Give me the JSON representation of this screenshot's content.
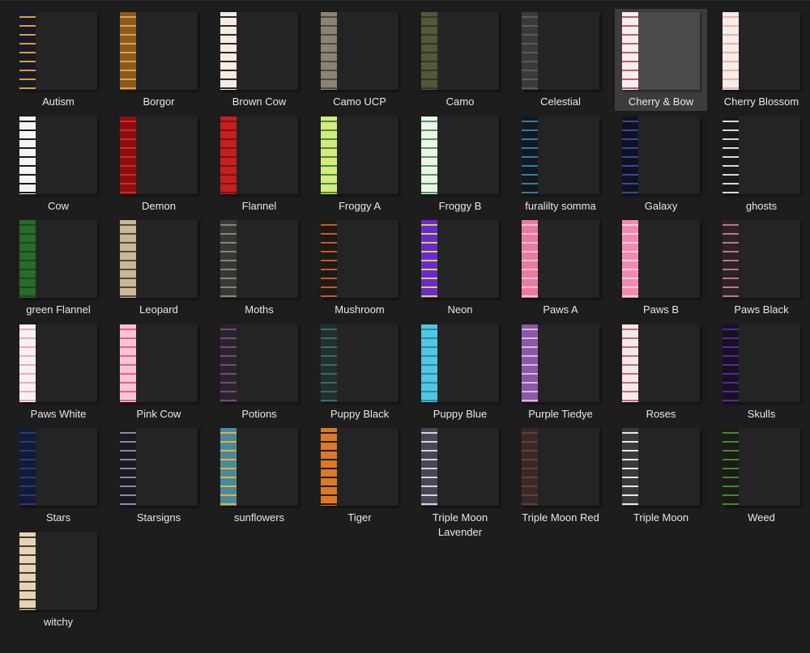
{
  "folder": {
    "items": [
      {
        "label": "Autism",
        "pattern": "autism-pattern",
        "colors": [
          "#1a1a2e",
          "#d9a32b"
        ]
      },
      {
        "label": "Borgor",
        "pattern": "borgor-pattern",
        "colors": [
          "#8a5a1e",
          "#e0a040"
        ]
      },
      {
        "label": "Brown Cow",
        "pattern": "brown-cow-pattern",
        "colors": [
          "#f0ece6",
          "#3a2418"
        ]
      },
      {
        "label": "Camo UCP",
        "pattern": "camo-ucp-pattern",
        "colors": [
          "#8a8476",
          "#4e4a40"
        ]
      },
      {
        "label": "Camo",
        "pattern": "camo-pattern",
        "colors": [
          "#4e5a3a",
          "#3a3226"
        ]
      },
      {
        "label": "Celestial",
        "pattern": "celestial-pattern",
        "colors": [
          "#3a3a38",
          "#5a5a56"
        ]
      },
      {
        "label": "Cherry & Bow",
        "pattern": "cherry-bow-pattern",
        "colors": [
          "#f6eef0",
          "#c05a6a"
        ]
      },
      {
        "label": "Cherry Blossom",
        "pattern": "cherry-blossom-pattern",
        "colors": [
          "#f7ece6",
          "#e7b2b6"
        ]
      },
      {
        "label": "Cow",
        "pattern": "cow-pattern",
        "colors": [
          "#f4f4f4",
          "#1b1b1b"
        ]
      },
      {
        "label": "Demon",
        "pattern": "demon-pattern",
        "colors": [
          "#8a1010",
          "#d42828"
        ]
      },
      {
        "label": "Flannel",
        "pattern": "flannel-pattern",
        "colors": [
          "#c42020",
          "#7a1414"
        ]
      },
      {
        "label": "Froggy A",
        "pattern": "froggy-a-pattern",
        "colors": [
          "#d6ea80",
          "#4a8a40"
        ]
      },
      {
        "label": "Froggy B",
        "pattern": "froggy-b-pattern",
        "colors": [
          "#eef2ea",
          "#4a9a5a"
        ]
      },
      {
        "label": "furalilty somma",
        "pattern": "furality-pattern",
        "colors": [
          "#121820",
          "#3a7a9a"
        ]
      },
      {
        "label": "Galaxy",
        "pattern": "galaxy-pattern",
        "colors": [
          "#0e1224",
          "#3a4a8a"
        ]
      },
      {
        "label": "ghosts",
        "pattern": "ghosts-pattern",
        "colors": [
          "#1a1a1a",
          "#d8d8d8"
        ]
      },
      {
        "label": "green Flannel",
        "pattern": "green-flannel-pattern",
        "colors": [
          "#2a6a2a",
          "#1a4a1a"
        ]
      },
      {
        "label": "Leopard",
        "pattern": "leopard-pattern",
        "colors": [
          "#c8b898",
          "#5a4a32"
        ]
      },
      {
        "label": "Moths",
        "pattern": "moths-pattern",
        "colors": [
          "#3a3834",
          "#8a8478"
        ]
      },
      {
        "label": "Mushroom",
        "pattern": "mushroom-pattern",
        "colors": [
          "#1e1a16",
          "#c05a3a"
        ]
      },
      {
        "label": "Neon",
        "pattern": "neon-pattern",
        "colors": [
          "#6a2ad2",
          "#d2da2a"
        ]
      },
      {
        "label": "Paws A",
        "pattern": "paws-a-pattern",
        "colors": [
          "#ec7aa0",
          "#f9c2d4"
        ]
      },
      {
        "label": "Paws B",
        "pattern": "paws-b-pattern",
        "colors": [
          "#f28ab0",
          "#fbd0de"
        ]
      },
      {
        "label": "Paws Black",
        "pattern": "paws-black-pattern",
        "colors": [
          "#2a2424",
          "#c27090"
        ]
      },
      {
        "label": "Paws White",
        "pattern": "paws-white-pattern",
        "colors": [
          "#f6f2f2",
          "#f2a6c0"
        ]
      },
      {
        "label": "Pink Cow",
        "pattern": "pink-cow-pattern",
        "colors": [
          "#f6c6d6",
          "#e4608e"
        ]
      },
      {
        "label": "Potions",
        "pattern": "potions-pattern",
        "colors": [
          "#2a2430",
          "#7a4a7a"
        ]
      },
      {
        "label": "Puppy Black",
        "pattern": "puppy-black-pattern",
        "colors": [
          "#20302e",
          "#3a6a66"
        ]
      },
      {
        "label": "Puppy Blue",
        "pattern": "puppy-blue-pattern",
        "colors": [
          "#52c6e2",
          "#2a8aa6"
        ]
      },
      {
        "label": "Purple Tiedye",
        "pattern": "purple-tiedye-pattern",
        "colors": [
          "#8a5aa6",
          "#e6b0e0"
        ]
      },
      {
        "label": "Roses",
        "pattern": "roses-pattern",
        "colors": [
          "#f4eaea",
          "#c86a7a"
        ]
      },
      {
        "label": "Skulls",
        "pattern": "skulls-pattern",
        "colors": [
          "#1a1026",
          "#5a2a8a"
        ]
      },
      {
        "label": "Stars",
        "pattern": "stars-pattern",
        "colors": [
          "#121a3a",
          "#2a3a7a"
        ]
      },
      {
        "label": "Starsigns",
        "pattern": "starsigns-pattern",
        "colors": [
          "#1a1a22",
          "#8a8aa6"
        ]
      },
      {
        "label": "sunflowers",
        "pattern": "sunflowers-pattern",
        "colors": [
          "#4a8aa0",
          "#e8b030"
        ]
      },
      {
        "label": "Tiger",
        "pattern": "tiger-pattern",
        "colors": [
          "#d87a2a",
          "#2a1a10"
        ]
      },
      {
        "label": "Triple Moon Lavender",
        "pattern": "triple-moon-lavender-pattern",
        "colors": [
          "#4a4656",
          "#d6d2e6"
        ]
      },
      {
        "label": "Triple Moon Red",
        "pattern": "triple-moon-red-pattern",
        "colors": [
          "#3a2828",
          "#6a3a3a"
        ]
      },
      {
        "label": "Triple Moon",
        "pattern": "triple-moon-pattern",
        "colors": [
          "#3a3a3a",
          "#e6e6e6"
        ]
      },
      {
        "label": "Weed",
        "pattern": "weed-pattern",
        "colors": [
          "#1a1a16",
          "#3a8a3a"
        ]
      },
      {
        "label": "witchy",
        "pattern": "witchy-pattern",
        "colors": [
          "#e6d2b6",
          "#4a3a2a"
        ]
      }
    ],
    "selected_index": 6
  },
  "colors": {
    "background": "#1d1d1d",
    "selection": "#3d3d3d",
    "text": "#e8e8e8"
  }
}
